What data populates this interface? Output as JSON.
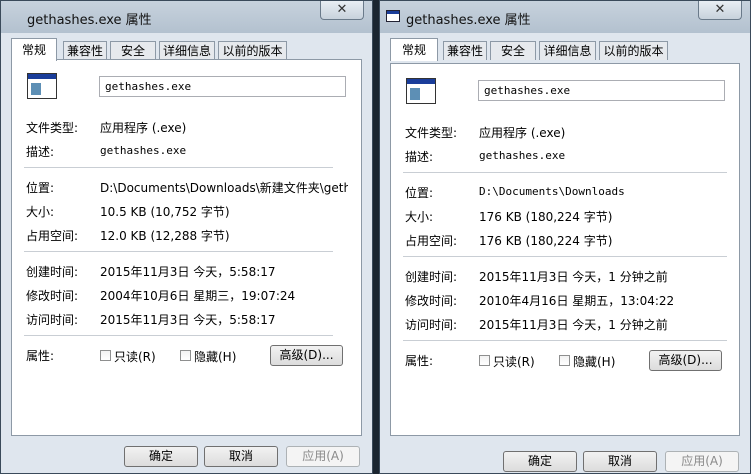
{
  "tabs": [
    "常规",
    "兼容性",
    "安全",
    "详细信息",
    "以前的版本"
  ],
  "labels": {
    "file_type": "文件类型:",
    "description": "描述:",
    "location": "位置:",
    "size": "大小:",
    "size_on_disk": "占用空间:",
    "created": "创建时间:",
    "modified": "修改时间:",
    "accessed": "访问时间:",
    "attributes": "属性:",
    "readonly": "只读(R)",
    "hidden": "隐藏(H)",
    "advanced": "高级(D)...",
    "ok": "确定",
    "cancel": "取消",
    "apply": "应用(A)",
    "close": "✕"
  },
  "dialog1": {
    "title": "gethashes.exe 属性",
    "filename": "gethashes.exe",
    "file_type": "应用程序 (.exe)",
    "description": "gethashes.exe",
    "location": "D:\\Documents\\Downloads\\新建文件夹\\gethash",
    "size": "10.5 KB (10,752 字节)",
    "size_on_disk": "12.0 KB (12,288 字节)",
    "created": "2015年11月3日 今天，5:58:17",
    "modified": "2004年10月6日 星期三，19:07:24",
    "accessed": "2015年11月3日 今天，5:58:17"
  },
  "dialog2": {
    "title": "gethashes.exe 属性",
    "filename": "gethashes.exe",
    "file_type": "应用程序 (.exe)",
    "description": "gethashes.exe",
    "location": "D:\\Documents\\Downloads",
    "size": "176 KB (180,224 字节)",
    "size_on_disk": "176 KB (180,224 字节)",
    "created": "2015年11月3日 今天，1 分钟之前",
    "modified": "2010年4月16日 星期五，13:04:22",
    "accessed": "2015年11月3日 今天，1 分钟之前"
  }
}
